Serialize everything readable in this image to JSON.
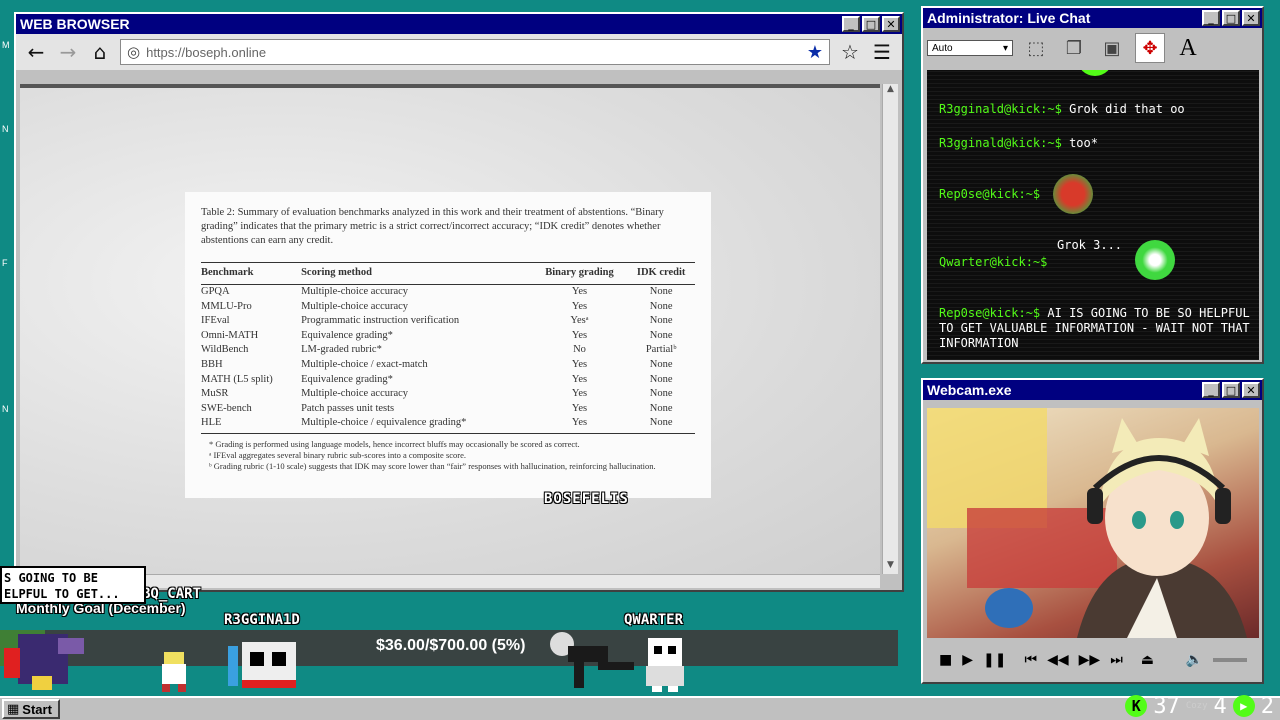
{
  "browser": {
    "title": "WEB BROWSER",
    "url": "https://boseph.online",
    "paper": {
      "caption": "Table 2: Summary of evaluation benchmarks analyzed in this work and their treatment of abstentions. “Binary grading” indicates that the primary metric is a strict correct/incorrect accuracy; “IDK credit” denotes whether abstentions can earn any credit.",
      "headers": [
        "Benchmark",
        "Scoring method",
        "Binary grading",
        "IDK credit"
      ],
      "rows": [
        [
          "GPQA",
          "Multiple-choice accuracy",
          "Yes",
          "None"
        ],
        [
          "MMLU-Pro",
          "Multiple-choice accuracy",
          "Yes",
          "None"
        ],
        [
          "IFEval",
          "Programmatic instruction verification",
          "Yesᵃ",
          "None"
        ],
        [
          "Omni-MATH",
          "Equivalence grading*",
          "Yes",
          "None"
        ],
        [
          "WildBench",
          "LM-graded rubric*",
          "No",
          "Partialᵇ"
        ],
        [
          "BBH",
          "Multiple-choice / exact-match",
          "Yes",
          "None"
        ],
        [
          "MATH (L5 split)",
          "Equivalence grading*",
          "Yes",
          "None"
        ],
        [
          "MuSR",
          "Multiple-choice accuracy",
          "Yes",
          "None"
        ],
        [
          "SWE-bench",
          "Patch passes unit tests",
          "Yes",
          "None"
        ],
        [
          "HLE",
          "Multiple-choice / equivalence grading*",
          "Yes",
          "None"
        ]
      ],
      "notes": [
        "* Grading is performed using language models, hence incorrect bluffs may occasionally be scored as correct.",
        "ᵃ IFEval aggregates several binary rubric sub-scores into a composite score.",
        "ᵇ Grading rubric (1-10 scale) suggests that IDK may score lower than “fair” responses with hallucination, reinforcing hallucination."
      ]
    },
    "watermark": "BOSEFELIS"
  },
  "chat": {
    "title": "Administrator: Live Chat",
    "combo_value": "Auto",
    "messages": [
      {
        "user": "R3gginald@kick:~$",
        "text": "Grok did that oo"
      },
      {
        "user": "R3gginald@kick:~$",
        "text": "too*"
      },
      {
        "user": "Rep0se@kick:~$",
        "text": ""
      },
      {
        "user": "",
        "text": "Grok 3..."
      },
      {
        "user": "Qwarter@kick:~$",
        "text": ""
      },
      {
        "user": "Rep0se@kick:~$",
        "text": "AI IS GOING TO BE SO HELPFUL TO GET VALUABLE INFORMATION - WAIT NOT THAT INFORMATION"
      }
    ]
  },
  "webcam": {
    "title": "Webcam.exe"
  },
  "overlay": {
    "popup_lines": [
      "S GOING TO BE",
      "ELPFUL TO GET..."
    ],
    "name_bq": "BQ_CART",
    "monthly_goal": "Monthly Goal (December)",
    "name_r3": "R3GGINA1D",
    "goal_text": "$36.00/$700.00 (5%)",
    "goal_percent": 5,
    "name_qwarter": "QWARTER"
  },
  "taskbar": {
    "start_label": "Start",
    "kick_count": "37",
    "cozy_label": "Cozy",
    "count_a": "4",
    "count_b": "2"
  }
}
